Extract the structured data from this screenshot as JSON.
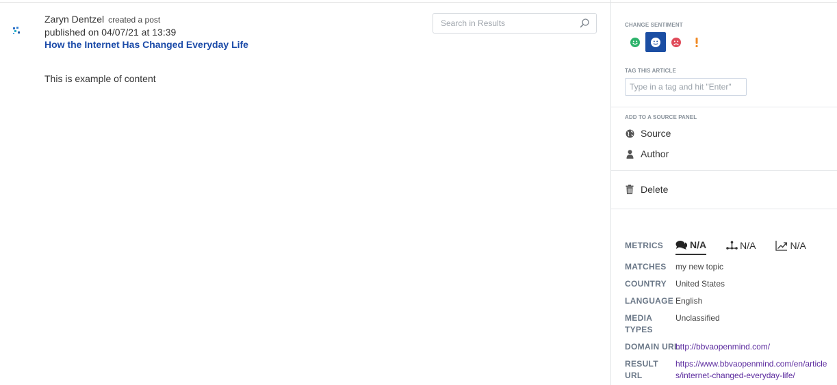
{
  "post": {
    "author": "Zaryn Dentzel",
    "action": "created a post",
    "published": "published on 04/07/21 at 13:39",
    "title": "How the Internet Has Changed Everyday Life",
    "content": "This is example of content",
    "source_icon": "network-dots-icon"
  },
  "search": {
    "placeholder": "Search in Results",
    "icon": "search-icon"
  },
  "panel": {
    "change_sentiment_label": "CHANGE SENTIMENT",
    "sentiment": {
      "options": [
        "positive",
        "neutral",
        "negative",
        "important"
      ],
      "selected": "neutral",
      "colors": {
        "positive": "#2db36b",
        "neutral": "#1b4ea3",
        "negative": "#e04b5a",
        "important": "#f08a24"
      }
    },
    "tag_label": "TAG THIS ARTICLE",
    "tag_placeholder": "Type in a tag and hit \"Enter\"",
    "add_source_label": "ADD TO A SOURCE PANEL",
    "source_label": "Source",
    "author_label": "Author",
    "delete_label": "Delete"
  },
  "metrics": {
    "label": "METRICS",
    "tabs": [
      {
        "icon": "comments-icon",
        "value": "N/A"
      },
      {
        "icon": "share-network-icon",
        "value": "N/A"
      },
      {
        "icon": "trend-up-icon",
        "value": "N/A"
      }
    ],
    "active_tab": 0
  },
  "details": {
    "matches_key": "MATCHES",
    "matches_val": "my new topic",
    "country_key": "COUNTRY",
    "country_val": "United States",
    "language_key": "LANGUAGE",
    "language_val": "English",
    "media_key": "MEDIA TYPES",
    "media_val": "Unclassified",
    "domain_key": "DOMAIN URL",
    "domain_val": "http://bbvaopenmind.com/",
    "result_key": "RESULT URL",
    "result_val": "https://www.bbvaopenmind.com/en/articles/internet-changed-everyday-life/"
  }
}
